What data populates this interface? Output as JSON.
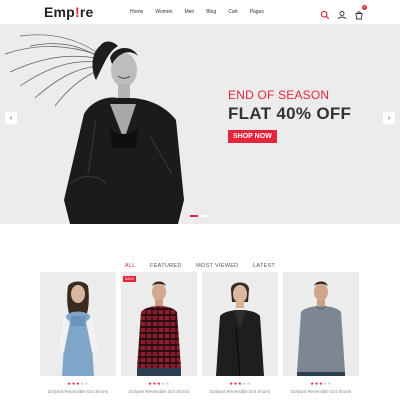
{
  "brand": {
    "prefix": "Emp",
    "accent": "!",
    "suffix": "re"
  },
  "nav": [
    "Home",
    "Women",
    "Men",
    "Blog",
    "Cart",
    "Pages"
  ],
  "header_icons": [
    "search-icon",
    "user-icon",
    "cart-icon"
  ],
  "cart_count": "0",
  "hero": {
    "subtitle": "END OF SEASON",
    "title": "FLAT 40% OFF",
    "button": "SHOP NOW"
  },
  "slider": {
    "slides": 2,
    "active": 0
  },
  "tabs": [
    "ALL",
    "FEATURED",
    "MOST VIEWED",
    "LATEST"
  ],
  "active_tab": 0,
  "products": [
    {
      "name": "Dofyant Reversible Dot Shorts",
      "rating": 3,
      "badge": ""
    },
    {
      "name": "Dofyant Reversible Dot Shorts",
      "rating": 3,
      "badge": "SALE"
    },
    {
      "name": "Dofyant Reversible Dot Shorts",
      "rating": 3,
      "badge": ""
    },
    {
      "name": "Dofyant Reversible Dot Shorts",
      "rating": 3,
      "badge": ""
    }
  ],
  "colors": {
    "accent": "#e3243b",
    "hero_bg": "#ececec",
    "text": "#333333"
  }
}
